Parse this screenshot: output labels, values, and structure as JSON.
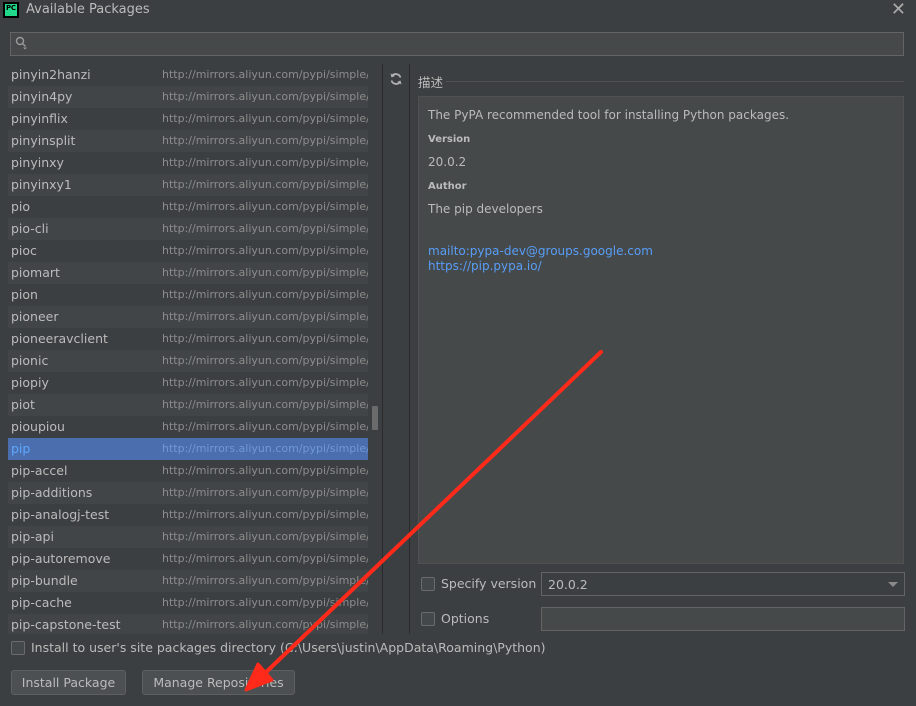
{
  "window": {
    "title": "Available Packages",
    "app_icon_text": "PC",
    "close_glyph": "✕"
  },
  "search": {
    "value": "",
    "placeholder": ""
  },
  "packages": {
    "repo_url": "http://mirrors.aliyun.com/pypi/simple/",
    "selected": "pip",
    "rows": [
      {
        "name": "pinyin2hanzi",
        "repo": "http://mirrors.aliyun.com/pypi/simple/"
      },
      {
        "name": "pinyin4py",
        "repo": "http://mirrors.aliyun.com/pypi/simple/"
      },
      {
        "name": "pinyinflix",
        "repo": "http://mirrors.aliyun.com/pypi/simple/"
      },
      {
        "name": "pinyinsplit",
        "repo": "http://mirrors.aliyun.com/pypi/simple/"
      },
      {
        "name": "pinyinxy",
        "repo": "http://mirrors.aliyun.com/pypi/simple/"
      },
      {
        "name": "pinyinxy1",
        "repo": "http://mirrors.aliyun.com/pypi/simple/"
      },
      {
        "name": "pio",
        "repo": "http://mirrors.aliyun.com/pypi/simple/"
      },
      {
        "name": "pio-cli",
        "repo": "http://mirrors.aliyun.com/pypi/simple/"
      },
      {
        "name": "pioc",
        "repo": "http://mirrors.aliyun.com/pypi/simple/"
      },
      {
        "name": "piomart",
        "repo": "http://mirrors.aliyun.com/pypi/simple/"
      },
      {
        "name": "pion",
        "repo": "http://mirrors.aliyun.com/pypi/simple/"
      },
      {
        "name": "pioneer",
        "repo": "http://mirrors.aliyun.com/pypi/simple/"
      },
      {
        "name": "pioneeravclient",
        "repo": "http://mirrors.aliyun.com/pypi/simple/"
      },
      {
        "name": "pionic",
        "repo": "http://mirrors.aliyun.com/pypi/simple/"
      },
      {
        "name": "piopiy",
        "repo": "http://mirrors.aliyun.com/pypi/simple/"
      },
      {
        "name": "piot",
        "repo": "http://mirrors.aliyun.com/pypi/simple/"
      },
      {
        "name": "pioupiou",
        "repo": "http://mirrors.aliyun.com/pypi/simple/"
      },
      {
        "name": "pip",
        "repo": "http://mirrors.aliyun.com/pypi/simple/"
      },
      {
        "name": "pip-accel",
        "repo": "http://mirrors.aliyun.com/pypi/simple/"
      },
      {
        "name": "pip-additions",
        "repo": "http://mirrors.aliyun.com/pypi/simple/"
      },
      {
        "name": "pip-analogj-test",
        "repo": "http://mirrors.aliyun.com/pypi/simple/"
      },
      {
        "name": "pip-api",
        "repo": "http://mirrors.aliyun.com/pypi/simple/"
      },
      {
        "name": "pip-autoremove",
        "repo": "http://mirrors.aliyun.com/pypi/simple/"
      },
      {
        "name": "pip-bundle",
        "repo": "http://mirrors.aliyun.com/pypi/simple/"
      },
      {
        "name": "pip-cache",
        "repo": "http://mirrors.aliyun.com/pypi/simple/"
      },
      {
        "name": "pip-capstone-test",
        "repo": "http://mirrors.aliyun.com/pypi/simple/"
      }
    ]
  },
  "description": {
    "label": "描述",
    "summary": "The PyPA recommended tool for installing Python packages.",
    "version_header": "Version",
    "version": "20.0.2",
    "author_header": "Author",
    "author": "The pip developers",
    "email_link": "mailto:pypa-dev@groups.google.com",
    "home_link": "https://pip.pypa.io/"
  },
  "options": {
    "specify_version_label": "Specify version",
    "specify_version_value": "20.0.2",
    "options_label": "Options",
    "options_value": "",
    "install_user_label": "Install to user's site packages directory (C:\\Users\\justin\\AppData\\Roaming\\Python)"
  },
  "buttons": {
    "install": "Install Package",
    "manage": "Manage Repositories"
  },
  "colors": {
    "background": "#3c3f41",
    "selection": "#4b6eaf",
    "link": "#589df6",
    "annotation_arrow": "#ff2a1a"
  },
  "icons": {
    "app": "pycharm-icon",
    "close": "close-icon",
    "search": "search-icon",
    "refresh": "refresh-icon",
    "dropdown": "chevron-down-icon"
  }
}
